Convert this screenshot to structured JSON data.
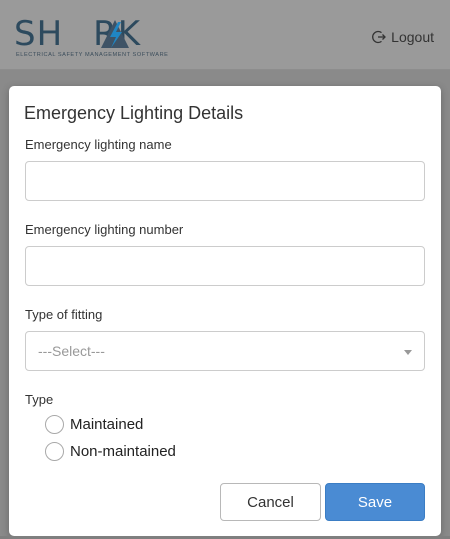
{
  "header": {
    "logo_text_left": "SH",
    "logo_text_right": "RK",
    "logo_tagline": "ELECTRICAL SAFETY MANAGEMENT SOFTWARE",
    "logout_label": "Logout"
  },
  "modal": {
    "title": "Emergency Lighting Details",
    "fields": {
      "name_label": "Emergency lighting name",
      "name_value": "",
      "number_label": "Emergency lighting number",
      "number_value": "",
      "fitting_label": "Type of fitting",
      "fitting_selected": "---Select---",
      "type_label": "Type"
    },
    "type_options": [
      "Maintained",
      "Non-maintained"
    ],
    "buttons": {
      "cancel": "Cancel",
      "save": "Save"
    }
  },
  "colors": {
    "primary": "#4a8bd3",
    "logo_blue": "#2d4a5e",
    "logo_bolt": "#1f86c4"
  }
}
